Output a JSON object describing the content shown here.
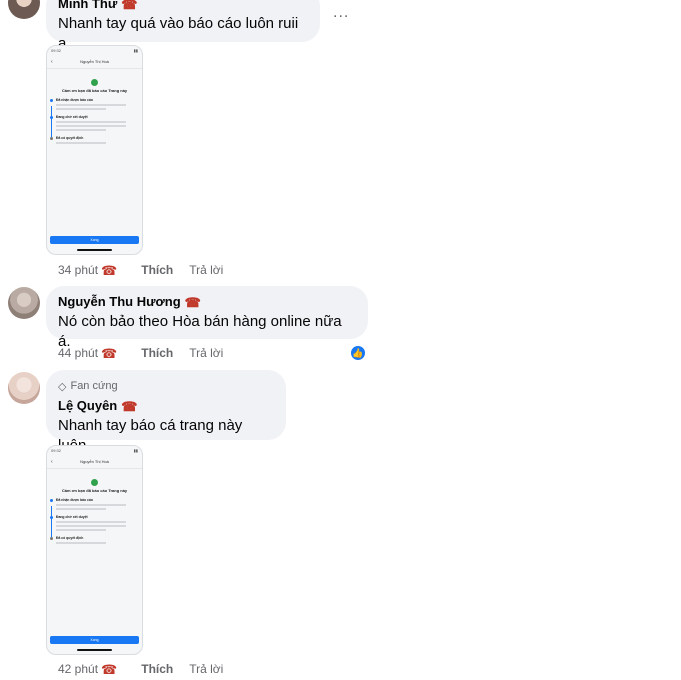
{
  "comments": [
    {
      "author": "Minh Thư",
      "text": "Nhanh tay quá vào báo cáo luôn ruii ạ",
      "time": "34 phút",
      "like_label": "Thích",
      "reply_label": "Trả lời",
      "more_label": "...",
      "icon": "telephone-icon",
      "attachment": {
        "status_time": "09:32",
        "header_title": "Nguyễn Thị Hoà",
        "message": "Cảm ơn bạn đã báo cáo Trang này",
        "steps": [
          "Đã nhận được báo cáo",
          "Đang chờ xét duyệt",
          "Đã có quyết định"
        ],
        "button_label": "Xong"
      }
    },
    {
      "author": "Nguyễn Thu Hương",
      "text": "Nó còn bảo theo Hòa bán hàng online nữa á.",
      "time": "44 phút",
      "like_label": "Thích",
      "reply_label": "Trả lời",
      "reaction": "like",
      "icon": "telephone-icon"
    },
    {
      "badge": "Fan cứng",
      "author": "Lệ Quyên",
      "text": "Nhanh tay báo cá trang này luôn",
      "time": "42 phút",
      "like_label": "Thích",
      "reply_label": "Trả lời",
      "icon": "telephone-icon",
      "attachment": {
        "status_time": "09:32",
        "header_title": "Nguyễn Thị Hoà",
        "message": "Cảm ơn bạn đã báo cáo Trang này",
        "steps": [
          "Đã nhận được báo cáo",
          "Đang chờ xét duyệt",
          "Đã có quyết định"
        ],
        "button_label": "Xong"
      }
    }
  ],
  "colors": {
    "bubble": "#f0f2f5",
    "meta_text": "#65676b",
    "accent": "#1877f2",
    "phone_icon": "#c0392b"
  }
}
